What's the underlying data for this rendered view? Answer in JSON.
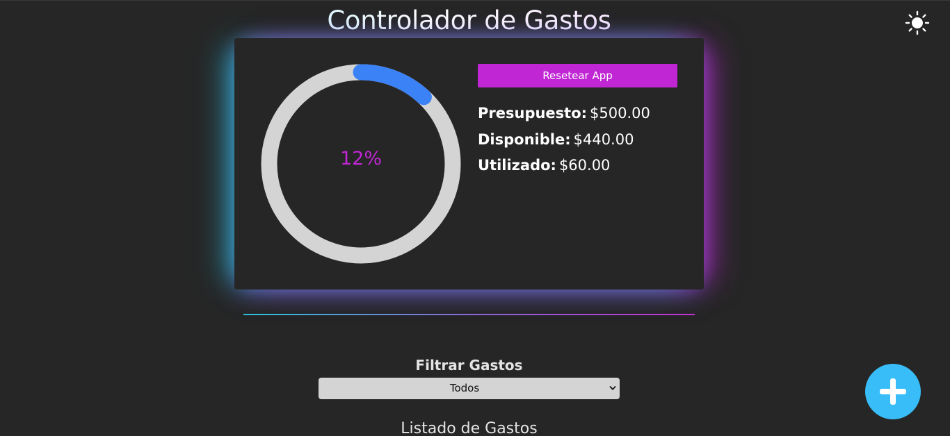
{
  "header": {
    "title": "Controlador de Gastos",
    "theme_icon": "sun-icon"
  },
  "budget": {
    "progress_percent": 12,
    "progress_label": "12%",
    "reset_label": "Resetear App",
    "stats": [
      {
        "label": "Presupuesto:",
        "value": "$500.00"
      },
      {
        "label": "Disponible:",
        "value": "$440.00"
      },
      {
        "label": "Utilizado:",
        "value": "$60.00"
      }
    ]
  },
  "filter": {
    "label": "Filtrar Gastos",
    "selected": "Todos"
  },
  "list": {
    "title": "Listado de Gastos"
  },
  "fab": {
    "icon": "plus-icon"
  },
  "colors": {
    "background": "#262626",
    "accent_magenta": "#c026d3",
    "progress_blue": "#3b82f6",
    "ring_track": "#d4d4d4",
    "fab_blue": "#38bdf8",
    "glow_cyan": "#28c8e6",
    "glow_magenta": "#c828dc"
  }
}
